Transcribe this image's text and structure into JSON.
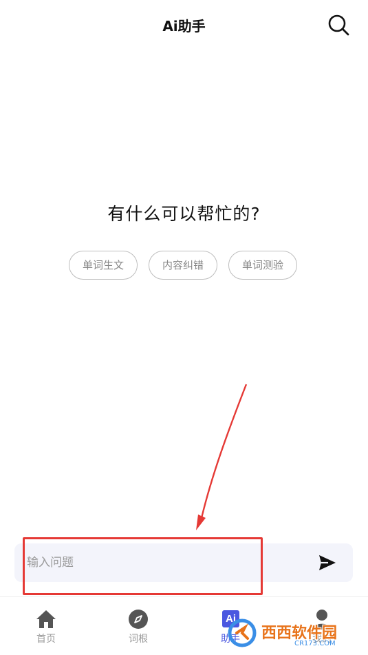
{
  "header": {
    "title": "Ai助手",
    "search_icon": "search-icon"
  },
  "main": {
    "greeting": "有什么可以帮忙的?",
    "suggestions": [
      {
        "label": "单词生文"
      },
      {
        "label": "内容纠错"
      },
      {
        "label": "单词测验"
      }
    ]
  },
  "composer": {
    "placeholder": "输入问题",
    "value": "",
    "send_icon": "send-icon"
  },
  "tabbar": {
    "active_index": 2,
    "tabs": [
      {
        "label": "首页",
        "icon": "home-icon"
      },
      {
        "label": "词根",
        "icon": "compass-icon"
      },
      {
        "label": "助手",
        "icon": "ai-icon",
        "badge": "Ai"
      },
      {
        "label": "我的",
        "icon": "user-icon"
      }
    ]
  },
  "watermark": {
    "text": "西西软件园",
    "sub": "CR173.COM"
  },
  "colors": {
    "accent": "#4a57e0",
    "input_background": "#f3f4fb",
    "chip_border": "#bdbdbd",
    "annotation_red": "#e53935"
  }
}
